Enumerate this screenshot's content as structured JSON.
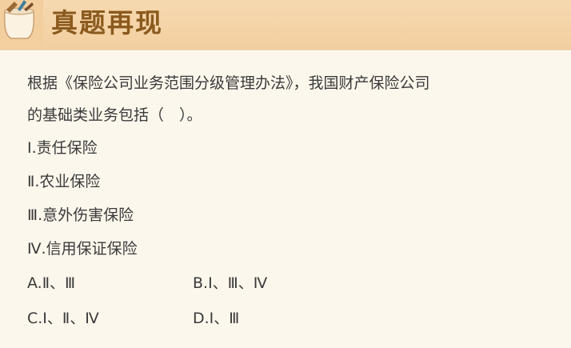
{
  "header": {
    "title": "真题再现",
    "icon": "pencil-cup-icon"
  },
  "question": {
    "line1": "根据《保险公司业务范围分级管理办法》，我国财产保险公司",
    "line2": "的基础类业务包括（　）。"
  },
  "items": [
    "Ⅰ.责任保险",
    "Ⅱ.农业保险",
    "Ⅲ.意外伤害保险",
    "Ⅳ.信用保证保险"
  ],
  "options": {
    "a": "A.Ⅱ、Ⅲ",
    "b": "B.Ⅰ、Ⅲ、Ⅳ",
    "c": "C.Ⅰ、Ⅱ、Ⅳ",
    "d": "D.Ⅰ、Ⅲ"
  }
}
